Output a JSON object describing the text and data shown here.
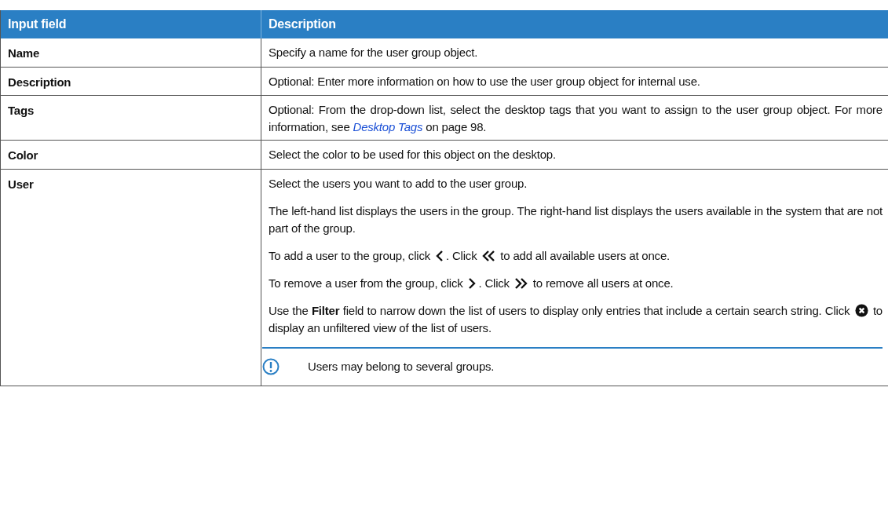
{
  "table": {
    "columns": [
      "Input field",
      "Description"
    ],
    "rows": [
      {
        "field": "Name",
        "blocks": [
          {
            "kind": "para",
            "parts": [
              {
                "kind": "text",
                "text": "Specify a name for the user group object."
              }
            ]
          }
        ]
      },
      {
        "field": "Description",
        "blocks": [
          {
            "kind": "para",
            "parts": [
              {
                "kind": "text",
                "text": "Optional: Enter more information on how to use the user group object for internal use."
              }
            ]
          }
        ]
      },
      {
        "field": "Tags",
        "blocks": [
          {
            "kind": "para",
            "parts": [
              {
                "kind": "text",
                "text": "Optional: From the drop-down list, select the desktop tags that you want to assign to the user group object. For more information, see "
              },
              {
                "kind": "link",
                "text": "Desktop Tags"
              },
              {
                "kind": "text",
                "text": " on page 98."
              }
            ]
          }
        ]
      },
      {
        "field": "Color",
        "blocks": [
          {
            "kind": "para",
            "parts": [
              {
                "kind": "text",
                "text": "Select the color to be used for this object on the desktop."
              }
            ]
          }
        ]
      },
      {
        "field": "User",
        "blocks": [
          {
            "kind": "para",
            "parts": [
              {
                "kind": "text",
                "text": "Select the users you want to add to the user group."
              }
            ]
          },
          {
            "kind": "para",
            "parts": [
              {
                "kind": "text",
                "text": "The left-hand list displays the users in the group. The right-hand list displays the users available in the system that are not part of the group."
              }
            ]
          },
          {
            "kind": "para",
            "parts": [
              {
                "kind": "text",
                "text": "To add a user to the group, click "
              },
              {
                "kind": "single-left"
              },
              {
                "kind": "text",
                "text": ". Click "
              },
              {
                "kind": "double-left"
              },
              {
                "kind": "text",
                "text": " to add all available users at once."
              }
            ]
          },
          {
            "kind": "para",
            "parts": [
              {
                "kind": "text",
                "text": "To remove a user from the group, click "
              },
              {
                "kind": "single-right"
              },
              {
                "kind": "text",
                "text": ". Click "
              },
              {
                "kind": "double-right"
              },
              {
                "kind": "text",
                "text": " to remove all users at once."
              }
            ]
          },
          {
            "kind": "para",
            "parts": [
              {
                "kind": "text",
                "text": "Use the **Filter** field to narrow down the list of users to display only entries that include a certain search string. Click "
              },
              {
                "kind": "clear"
              },
              {
                "kind": "text",
                "text": " to display an unfiltered view of the list of users."
              }
            ]
          },
          {
            "kind": "note",
            "text": "Users may belong to several groups."
          }
        ]
      }
    ]
  }
}
